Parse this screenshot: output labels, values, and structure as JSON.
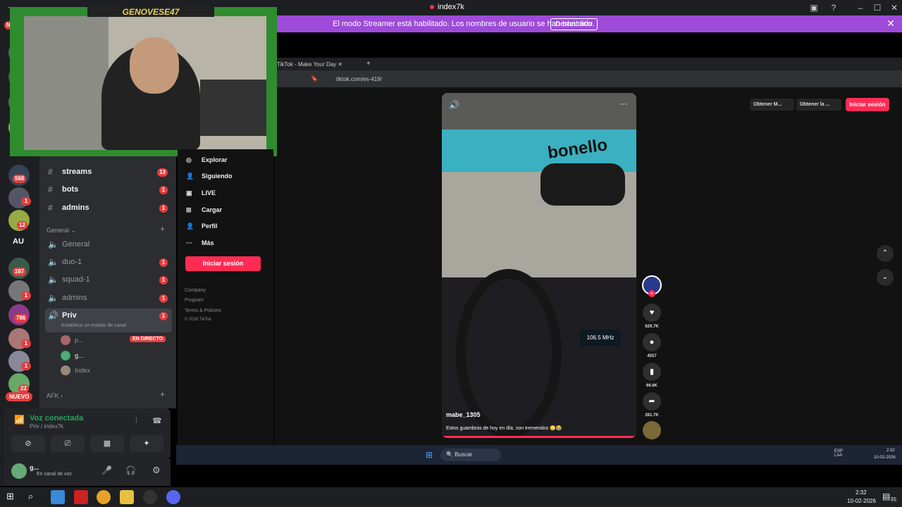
{
  "window": {
    "title": "index7k",
    "colors": {
      "accent": "#9d4bd8",
      "danger": "#e63d3d",
      "tiktok": "#fe2c55",
      "voice_green": "#23a55a"
    }
  },
  "streamer_banner": {
    "message": "El modo Streamer está habilitado. Los nombres de usuario se han truncado.",
    "button": "Deshabilitar"
  },
  "webcam": {
    "overlay_name": "GENOVESE47"
  },
  "server_rail": {
    "badges": [
      "568",
      "1",
      "12",
      "287",
      "1",
      "786",
      "1",
      "1",
      "22"
    ],
    "au_label": "AU",
    "new_label": "NUEVO",
    "top_badge": "NE"
  },
  "channels": {
    "text": [
      {
        "name": "streams",
        "count": "13"
      },
      {
        "name": "bots",
        "count": "1"
      },
      {
        "name": "admins",
        "count": "1"
      }
    ],
    "category": "General",
    "voice": [
      {
        "name": "General",
        "count": ""
      },
      {
        "name": "duo-1",
        "count": "1"
      },
      {
        "name": "squad-1",
        "count": "1"
      },
      {
        "name": "admins",
        "count": "1"
      }
    ],
    "active": {
      "name": "Priv",
      "count": "1",
      "status": "Establece un estado de canal"
    },
    "members": [
      {
        "name": "p...",
        "badge": "EN DIRECTO"
      },
      {
        "name": "g...",
        "badge": ""
      },
      {
        "name": "Index",
        "badge": ""
      }
    ],
    "afk_category": "AFK"
  },
  "voice_panel": {
    "title": "Voz conectada",
    "subtitle": "Priv / index7k"
  },
  "user_panel": {
    "name": "g...",
    "status": "En canal de voz"
  },
  "browser": {
    "tab_title": "TikTok - Make Your Day",
    "url": "tiktok.com/es-419/"
  },
  "tiktok": {
    "nav": [
      "Explorar",
      "Siguiendo",
      "LIVE",
      "Cargar",
      "Perfil",
      "Más"
    ],
    "nav_icons": [
      "compass-icon",
      "following-icon",
      "live-icon",
      "upload-icon",
      "profile-icon",
      "more-icon"
    ],
    "login": "Iniciar sesión",
    "footer": [
      "Company",
      "Program",
      "Terms & Policies",
      "© 2026 TikTok"
    ],
    "top_right": {
      "btn1": "Obtener M...",
      "btn2": "Obtener la ...",
      "login": "Iniciar sesión"
    },
    "video": {
      "username": "mabe_1305",
      "caption": "Estos guambras de hoy en día, son tremendos 😳😂",
      "radio": "106.5 MHz",
      "shop_sign": "bonello"
    },
    "actions": [
      {
        "icon": "heart-icon",
        "count": "629.7K"
      },
      {
        "icon": "comment-icon",
        "count": "4557"
      },
      {
        "icon": "bookmark-icon",
        "count": "66.6K"
      },
      {
        "icon": "share-icon",
        "count": "281.7K"
      }
    ]
  },
  "inner_taskbar": {
    "search": "Buscar",
    "lang": "ESP\nLAA",
    "time": "2:32",
    "date": "10-02-2026"
  },
  "taskbar": {
    "lang": "ESP\nLAA",
    "time": "2:32",
    "date": "10-02-2026",
    "notif": "21"
  }
}
